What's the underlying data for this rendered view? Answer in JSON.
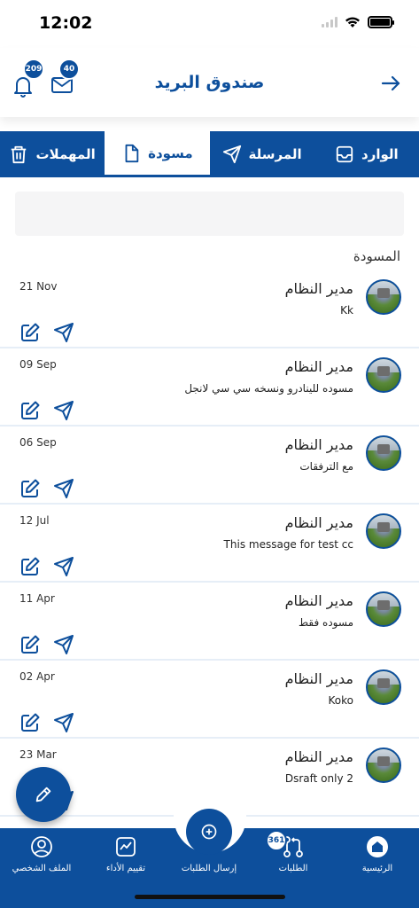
{
  "status": {
    "time": "12:02"
  },
  "header": {
    "title": "صندوق البريد",
    "bell_count": "209",
    "mail_count": "40"
  },
  "tabs": [
    {
      "label": "الوارد",
      "icon": "inbox-icon"
    },
    {
      "label": "المرسلة",
      "icon": "send-icon"
    },
    {
      "label": "مسودة",
      "icon": "document-icon",
      "active": true
    },
    {
      "label": "المهملات",
      "icon": "trash-icon"
    }
  ],
  "section_title": "المسودة",
  "messages": [
    {
      "sender": "مدير النظام",
      "subject": "Kk",
      "date": "21 Nov"
    },
    {
      "sender": "مدير النظام",
      "subject": "مسوده للينادرو ونسخه سي سي لانجل",
      "date": "09 Sep"
    },
    {
      "sender": "مدير النظام",
      "subject": "مع الترفقات",
      "date": "06 Sep"
    },
    {
      "sender": "مدير النظام",
      "subject": "This message for test cc",
      "date": "12 Jul"
    },
    {
      "sender": "مدير النظام",
      "subject": "مسوده فقط",
      "date": "11 Apr"
    },
    {
      "sender": "مدير النظام",
      "subject": "Koko",
      "date": "02 Apr"
    },
    {
      "sender": "مدير النظام",
      "subject": "Dsraft only 2",
      "date": "23 Mar"
    }
  ],
  "bottom_nav": {
    "home": "الرئيسية",
    "requests": "الطلبات",
    "requests_count": "361",
    "send_requests": "إرسال الطلبات",
    "performance": "تقييم الأداء",
    "profile": "الملف الشخصي"
  },
  "colors": {
    "primary": "#0d4f9c",
    "divider": "#e6eef7",
    "search_bg": "#f5f5f6"
  }
}
